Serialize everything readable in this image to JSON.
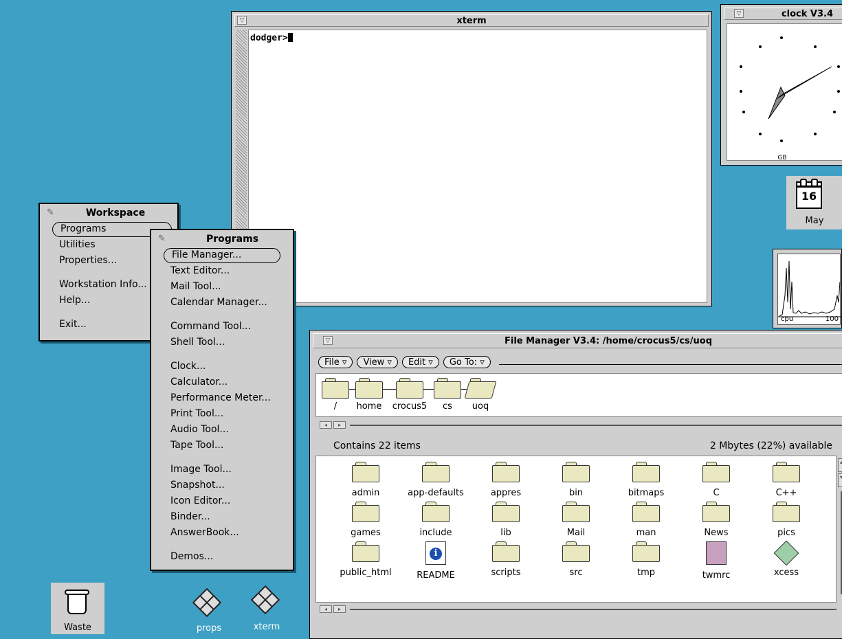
{
  "xterm": {
    "title": "xterm",
    "prompt": "dodger>"
  },
  "clock": {
    "title": "clock V3.4",
    "zone_label": "GB"
  },
  "calendar": {
    "day": "16",
    "month": "May"
  },
  "perfmeter": {
    "label": "cpu",
    "value": "100"
  },
  "workspace_menu": {
    "title": "Workspace",
    "items": [
      "Programs",
      "Utilities",
      "Properties...",
      "Workstation Info...",
      "Help...",
      "Exit..."
    ]
  },
  "programs_menu": {
    "title": "Programs",
    "items": [
      "File Manager...",
      "Text Editor...",
      "Mail Tool...",
      "Calendar Manager...",
      "Command Tool...",
      "Shell Tool...",
      "Clock...",
      "Calculator...",
      "Performance Meter...",
      "Print Tool...",
      "Audio Tool...",
      "Tape Tool...",
      "Image Tool...",
      "Snapshot...",
      "Icon Editor...",
      "Binder...",
      "AnswerBook...",
      "Demos..."
    ]
  },
  "file_manager": {
    "title": "File Manager V3.4: /home/crocus5/cs/uoq",
    "menus": [
      "File",
      "View",
      "Edit",
      "Go To:"
    ],
    "path": [
      "/",
      "home",
      "crocus5",
      "cs",
      "uoq"
    ],
    "status_left": "Contains 22 items",
    "status_right": "2 Mbytes (22%) available",
    "items": [
      "admin",
      "app-defaults",
      "appres",
      "bin",
      "bitmaps",
      "C",
      "C++",
      "games",
      "include",
      "lib",
      "Mail",
      "man",
      "News",
      "pics",
      "public_html",
      "README",
      "scripts",
      "src",
      "tmp",
      "twmrc",
      "xcess"
    ]
  },
  "desktop_icons": {
    "waste": "Waste",
    "props": "props",
    "xterm": "xterm"
  },
  "colors": {
    "desktop": "#3da0c4",
    "window": "#cfcfcf",
    "folder": "#eae8c0"
  }
}
